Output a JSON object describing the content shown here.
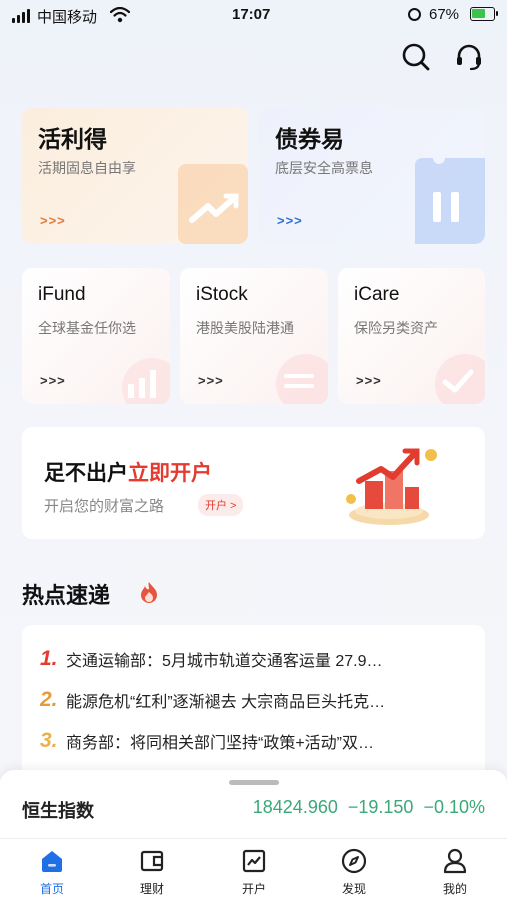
{
  "status_bar": {
    "carrier": "中国移动",
    "time": "17:07",
    "battery_percent": "67%",
    "battery_level": 0.67,
    "accent_green": "#3cc24d"
  },
  "header": {
    "search_icon": "search-icon",
    "support_icon": "headset-icon"
  },
  "feature_cards": [
    {
      "title": "活利得",
      "subtitle": "活期固息自由享",
      "more": ">>>",
      "arrow_color": "#e07a3b",
      "bg": "#fdf0e6",
      "icon": "trend-up-icon"
    },
    {
      "title": "债券易",
      "subtitle": "底层安全高票息",
      "more": ">>>",
      "arrow_color": "#2f6fd1",
      "bg": "#eef2fc",
      "icon": "ticket-icon"
    }
  ],
  "product_cards": [
    {
      "title": "iFund",
      "subtitle": "全球基金任你选",
      "more": ">>>",
      "icon": "bar-chart-icon"
    },
    {
      "title": "iStock",
      "subtitle": "港股美股陆港通",
      "more": ">>>",
      "icon": "exchange-icon"
    },
    {
      "title": "iCare",
      "subtitle": "保险另类资产",
      "more": ">>>",
      "icon": "check-icon"
    }
  ],
  "open_account": {
    "title_prefix": "足不出户",
    "title_accent": "立即开户",
    "subtitle": "开启您的财富之路",
    "pill": "开户 >",
    "accent_color": "#e43a2f"
  },
  "hot_news": {
    "title": "热点速递",
    "items": [
      {
        "num": "1.",
        "text": "交通运输部：5月城市轨道交通客运量 27.9…",
        "color": "#e43a2f"
      },
      {
        "num": "2.",
        "text": "能源危机“红利”逐渐褪去 大宗商品巨头托克…",
        "color": "#e79a3a"
      },
      {
        "num": "3.",
        "text": "商务部：将同相关部门坚持“政策+活动”双…",
        "color": "#e9b24a"
      }
    ]
  },
  "index_ticker": {
    "name": "恒生指数",
    "value": "18424.960",
    "change": "−19.150",
    "change_pct": "−0.10%",
    "color": "#3aa878"
  },
  "tabbar": {
    "items": [
      {
        "label": "首页",
        "icon": "home-icon",
        "active": true
      },
      {
        "label": "理财",
        "icon": "wallet-icon",
        "active": false
      },
      {
        "label": "开户",
        "icon": "chart-card-icon",
        "active": false
      },
      {
        "label": "发现",
        "icon": "compass-icon",
        "active": false
      },
      {
        "label": "我的",
        "icon": "user-icon",
        "active": false
      }
    ],
    "active_color": "#1f6fe6"
  }
}
